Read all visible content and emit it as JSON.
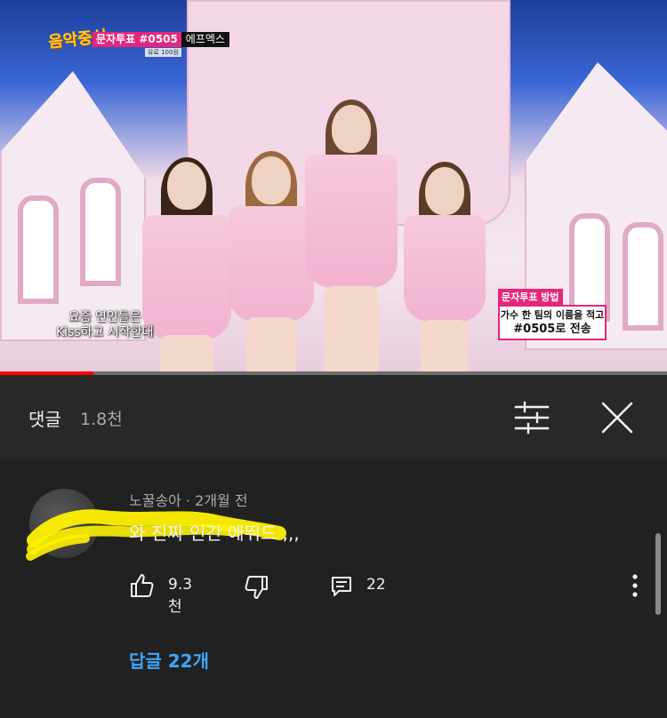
{
  "video": {
    "logo": "음악중심",
    "vote_tag": "문자투표 #0505",
    "vote_name": "에프엑스",
    "vote_fee": "유료 100원",
    "subtitle_line1": "요즘 연인들은",
    "subtitle_line2": "Kiss하고 시작한대",
    "vote_box_title": "문자투표 방법",
    "vote_box_line1": "가수 한 팀의 이름을 적고",
    "vote_box_line2": "#0505로 전송",
    "progress_fraction": 0.14
  },
  "comments_panel": {
    "title": "댓글",
    "count": "1.8천",
    "sort_icon": "sort-filter-icon",
    "close_icon": "close-icon"
  },
  "comment": {
    "author_meta": "노꿀송아 · 2개월 전",
    "text": "와 진짜 인간 에뛰드 ,,,",
    "likes": "9.3천",
    "replies_count": "22",
    "replies_link": "답글 22개",
    "icons": {
      "like": "thumbs-up-icon",
      "dislike": "thumbs-down-icon",
      "reply": "reply-icon",
      "more": "more-vertical-icon"
    }
  },
  "colors": {
    "background": "#212121",
    "header_bg": "#282828",
    "link": "#3ea6ff",
    "progress": "#ff0000",
    "scribble": "#fff200"
  }
}
